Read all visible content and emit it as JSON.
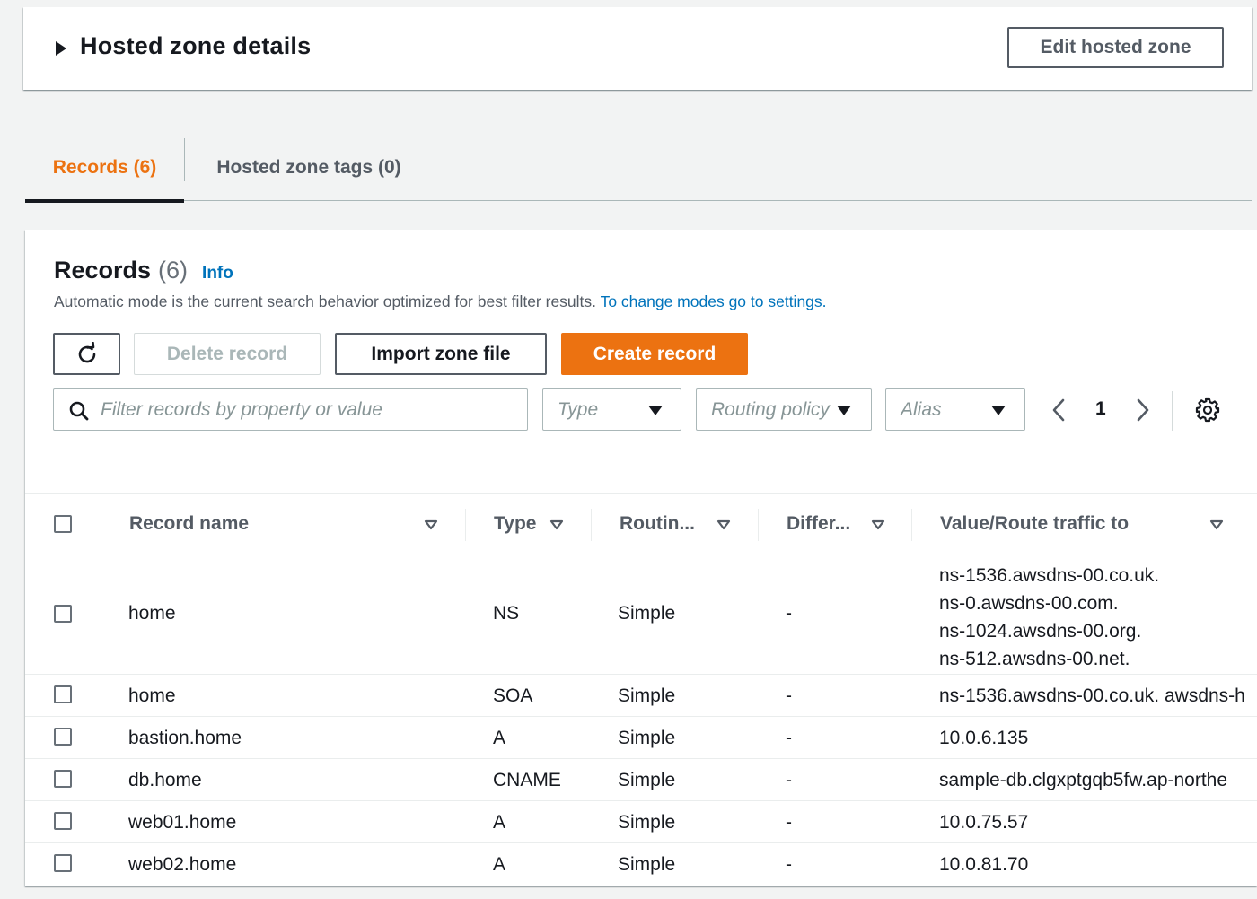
{
  "zone_panel": {
    "title": "Hosted zone details",
    "edit_label": "Edit hosted zone"
  },
  "tabs": [
    {
      "label": "Records (6)",
      "active": true
    },
    {
      "label": "Hosted zone tags (0)",
      "active": false
    }
  ],
  "records": {
    "title": "Records",
    "count": "(6)",
    "info_label": "Info",
    "description": "Automatic mode is the current search behavior optimized for best filter results.",
    "settings_link": "To change modes go to settings.",
    "actions": {
      "delete_label": "Delete record",
      "import_label": "Import zone file",
      "create_label": "Create record"
    },
    "filter": {
      "placeholder": "Filter records by property or value",
      "type_placeholder": "Type",
      "routing_placeholder": "Routing policy",
      "alias_placeholder": "Alias"
    },
    "pagination": {
      "current_page": "1"
    },
    "columns": [
      "Record name",
      "Type",
      "Routin...",
      "Differ...",
      "Value/Route traffic to"
    ],
    "rows": [
      {
        "name": "home",
        "type": "NS",
        "routing": "Simple",
        "differentiator": "-",
        "values": [
          "ns-1536.awsdns-00.co.uk.",
          "ns-0.awsdns-00.com.",
          "ns-1024.awsdns-00.org.",
          "ns-512.awsdns-00.net."
        ]
      },
      {
        "name": "home",
        "type": "SOA",
        "routing": "Simple",
        "differentiator": "-",
        "value": "ns-1536.awsdns-00.co.uk. awsdns-h"
      },
      {
        "name": "bastion.home",
        "type": "A",
        "routing": "Simple",
        "differentiator": "-",
        "value": "10.0.6.135"
      },
      {
        "name": "db.home",
        "type": "CNAME",
        "routing": "Simple",
        "differentiator": "-",
        "value": "sample-db.clgxptgqb5fw.ap-northe"
      },
      {
        "name": "web01.home",
        "type": "A",
        "routing": "Simple",
        "differentiator": "-",
        "value": "10.0.75.57"
      },
      {
        "name": "web02.home",
        "type": "A",
        "routing": "Simple",
        "differentiator": "-",
        "value": "10.0.81.70"
      }
    ]
  },
  "colors": {
    "accent_orange": "#ec7211",
    "link_blue": "#0073bb",
    "text_dark": "#16191f",
    "text_muted": "#545b64",
    "border": "#aab7b8"
  },
  "icons": [
    "caret-right-icon",
    "refresh-icon",
    "search-icon",
    "caret-down-icon",
    "chevron-left-icon",
    "chevron-right-icon",
    "gear-icon",
    "sort-icon"
  ]
}
